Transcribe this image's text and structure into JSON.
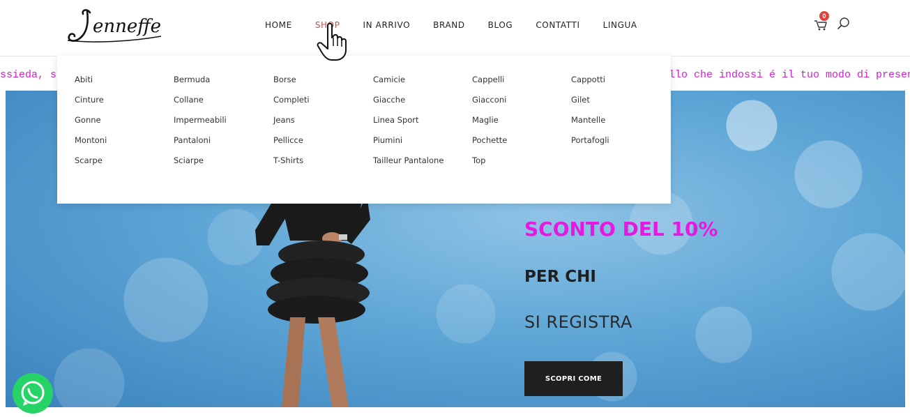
{
  "brand": {
    "logo_text": "Jenneffe"
  },
  "nav": [
    {
      "label": "HOME"
    },
    {
      "label": "SHOP",
      "active": true
    },
    {
      "label": "IN ARRIVO"
    },
    {
      "label": "BRAND"
    },
    {
      "label": "BLOG"
    },
    {
      "label": "CONTATTI"
    },
    {
      "label": "LINGUA"
    }
  ],
  "cart": {
    "count": "0",
    "icon": "cart-icon"
  },
  "search": {
    "icon": "search-icon"
  },
  "marquee": {
    "left_text": "ssieda, sii",
    "right_text": "ello che indossi é il tuo modo di presentar"
  },
  "mega_menu": {
    "columns": [
      [
        "Abiti",
        "Cinture",
        "Gonne",
        "Montoni",
        "Scarpe"
      ],
      [
        "Bermuda",
        "Collane",
        "Impermeabili",
        "Pantaloni",
        "Sciarpe"
      ],
      [
        "Borse",
        "Completi",
        "Jeans",
        "Pellicce",
        "T-Shirts"
      ],
      [
        "Camicie",
        "Giacche",
        "Linea Sport",
        "Piumini",
        "Tailleur Pantalone"
      ],
      [
        "Cappelli",
        "Giacconi",
        "Maglie",
        "Pochette",
        "Top"
      ],
      [
        "Cappotti",
        "Gilet",
        "Mantelle",
        "Portafogli"
      ]
    ]
  },
  "hero": {
    "line1": "SCONTO DEL 10%",
    "line2": "PER CHI",
    "line3": "SI REGISTRA",
    "cta_label": "SCOPRI COME"
  },
  "colors": {
    "accent_red": "#e0453d",
    "promo_magenta": "#e619e0",
    "marquee_magenta": "#d61fd2",
    "dark": "#1f1f1f",
    "whatsapp_green": "#25d366"
  }
}
